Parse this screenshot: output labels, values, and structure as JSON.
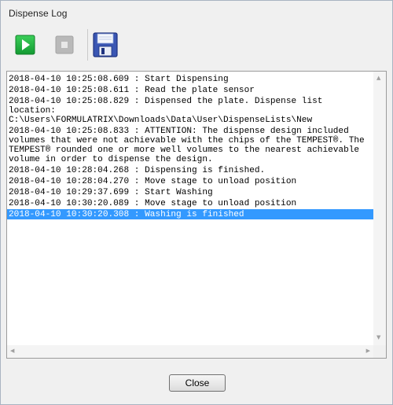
{
  "window": {
    "title": "Dispense Log"
  },
  "toolbar": {
    "start_icon": "play-icon",
    "stop_icon": "stop-icon",
    "save_icon": "save-floppy-icon",
    "colors": {
      "play_green": "#1fae3d",
      "stop_gray": "#b4b4b4",
      "floppy_blue": "#3a56b3"
    }
  },
  "log": {
    "entries": [
      "2018-04-10 10:25:08.609 : Start Dispensing",
      "2018-04-10 10:25:08.611 : Read the plate sensor",
      "2018-04-10 10:25:08.829 : Dispensed the plate. Dispense list location:\nC:\\Users\\FORMULATRIX\\Downloads\\Data\\User\\DispenseLists\\New",
      "2018-04-10 10:25:08.833 : ATTENTION: The dispense design included volumes that were not achievable with the chips of the TEMPEST®. The TEMPEST® rounded one or more well volumes to the nearest achievable volume in order to dispense the design.",
      "2018-04-10 10:28:04.268 : Dispensing is finished.",
      "2018-04-10 10:28:04.270 : Move stage to unload position",
      "2018-04-10 10:29:37.699 : Start Washing",
      "2018-04-10 10:30:20.089 : Move stage to unload position",
      "2018-04-10 10:30:20.308 : Washing is finished"
    ],
    "selected_index": 8,
    "selection_color": "#3399ff"
  },
  "footer": {
    "close_label": "Close"
  }
}
